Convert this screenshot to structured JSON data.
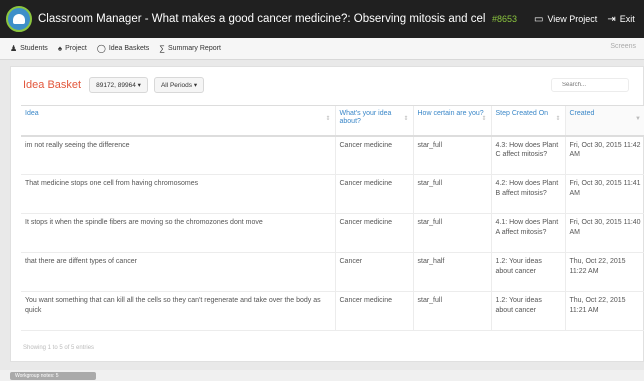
{
  "topbar": {
    "title": "Classroom Manager - What makes a good cancer medicine?: Observing mitosis and cell proce...",
    "run_id": "#8653",
    "view_project": "View Project",
    "exit": "Exit"
  },
  "tabs": [
    {
      "label": "Students",
      "icon": "students-icon"
    },
    {
      "label": "Project",
      "icon": "project-icon"
    },
    {
      "label": "Idea Baskets",
      "icon": "lightbulb-icon"
    },
    {
      "label": "Summary Report",
      "icon": "chart-icon"
    }
  ],
  "screens_label": "Screens",
  "panel": {
    "title": "Idea Basket",
    "filter_workgroups": "89172, 89964",
    "filter_periods": "All Periods",
    "search_placeholder": "Search..."
  },
  "table": {
    "columns": [
      "Idea",
      "What's your idea about?",
      "How certain are you?",
      "Step Created On",
      "Created"
    ],
    "rows": [
      [
        "im not really seeing the difference",
        "Cancer medicine",
        "star_full",
        "4.3: How does Plant C affect mitosis?",
        "Fri, Oct 30, 2015 11:42 AM"
      ],
      [
        "That medicine stops one cell from having chromosomes",
        "Cancer medicine",
        "star_full",
        "4.2: How does Plant B affect mitosis?",
        "Fri, Oct 30, 2015 11:41 AM"
      ],
      [
        "It stops it when the spindle fibers are moving so the chromozones dont move",
        "Cancer medicine",
        "star_full",
        "4.1: How does Plant A affect mitosis?",
        "Fri, Oct 30, 2015 11:40 AM"
      ],
      [
        "that there are diffent types of cancer",
        "Cancer",
        "star_half",
        "1.2: Your ideas about cancer",
        "Thu, Oct 22, 2015 11:22 AM"
      ],
      [
        "You want something that can kill all the cells so they can't regenerate and take over the body as quick",
        "Cancer medicine",
        "star_full",
        "1.2: Your ideas about cancer",
        "Thu, Oct 22, 2015 11:21 AM"
      ]
    ],
    "footer": "Showing 1 to 5 of 5 entries"
  },
  "bottom_button": "Workgroup notes: 5"
}
